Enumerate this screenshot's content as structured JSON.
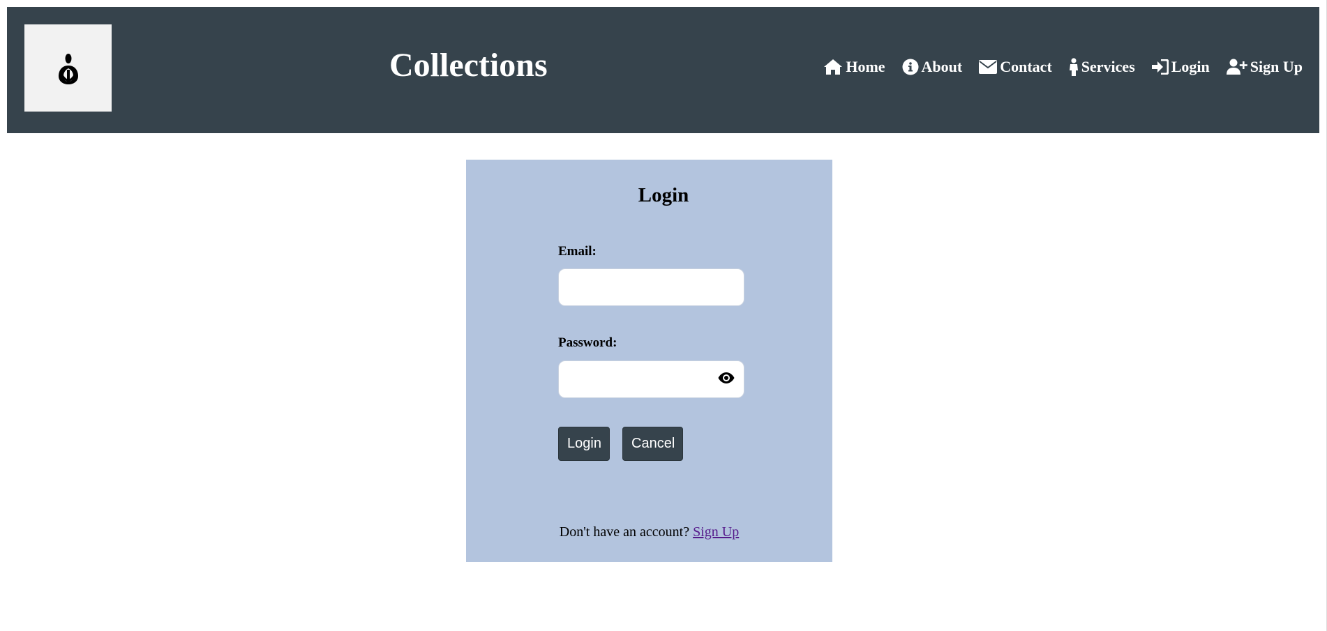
{
  "header": {
    "logo_icon": "tulip-logo-icon",
    "title": "Collections",
    "background": "#36434c"
  },
  "nav": {
    "items": [
      {
        "label": "Home",
        "icon": "home-icon"
      },
      {
        "label": "About",
        "icon": "info-icon"
      },
      {
        "label": "Contact",
        "icon": "envelope-icon"
      },
      {
        "label": "Services",
        "icon": "person-icon"
      },
      {
        "label": "Login",
        "icon": "sign-in-icon"
      },
      {
        "label": "Sign Up",
        "icon": "user-plus-icon"
      }
    ]
  },
  "login": {
    "title": "Login",
    "background": "#b3c4de",
    "email_label": "Email:",
    "email_value": "",
    "password_label": "Password:",
    "password_value": "",
    "password_toggle_icon": "eye-icon",
    "login_button": "Login",
    "cancel_button": "Cancel",
    "signup_prompt": "Don't have an account?",
    "signup_link": "Sign Up"
  }
}
